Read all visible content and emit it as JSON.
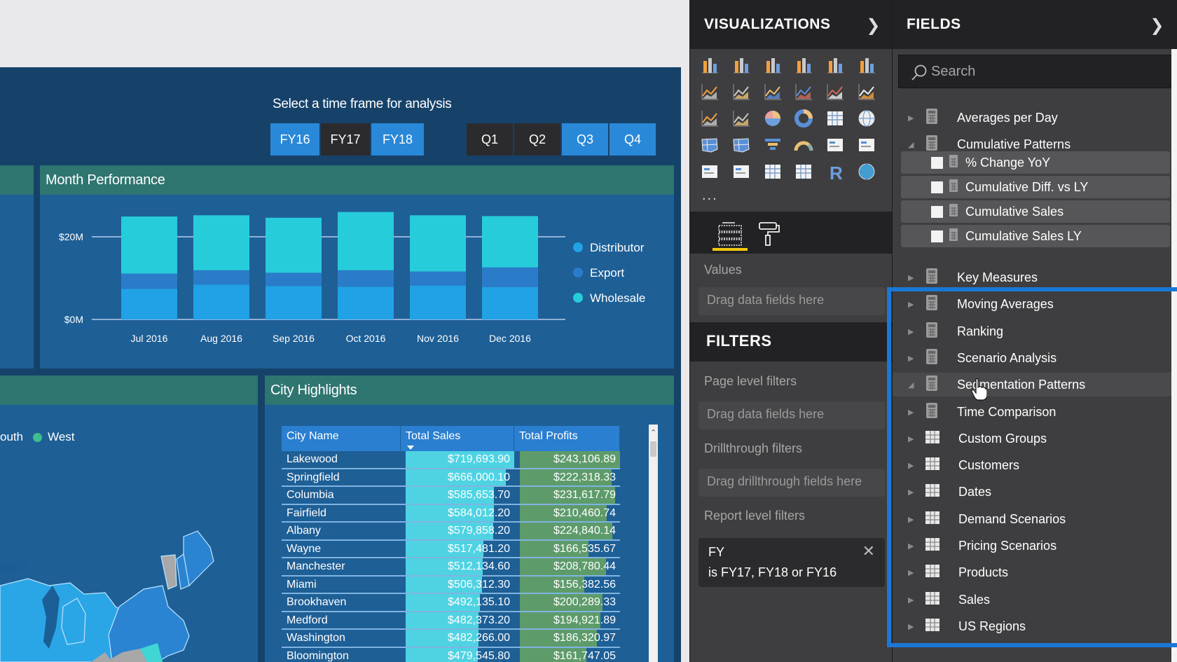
{
  "report": {
    "timeframe_title": "Select a time frame for analysis",
    "fy_buttons": [
      {
        "label": "FY16",
        "selected": true
      },
      {
        "label": "FY17",
        "selected": false
      },
      {
        "label": "FY18",
        "selected": true
      }
    ],
    "q_buttons": [
      {
        "label": "Q1",
        "selected": false
      },
      {
        "label": "Q2",
        "selected": false
      },
      {
        "label": "Q3",
        "selected": true
      },
      {
        "label": "Q4",
        "selected": true
      }
    ],
    "month_panel_title": "Month Performance",
    "city_panel_title": "City Highlights",
    "map_legend": [
      {
        "label": "outh",
        "color": "#2aa0e8"
      },
      {
        "label": "West",
        "color": "#3fbf8f"
      }
    ]
  },
  "chart_data": {
    "type": "bar",
    "stacked": true,
    "title": "Month Performance",
    "categories": [
      "Jul 2016",
      "Aug 2016",
      "Sep 2016",
      "Oct 2016",
      "Nov 2016",
      "Dec 2016"
    ],
    "series": [
      {
        "name": "Distributor",
        "color": "#21a2e6",
        "values": [
          7.4,
          8.4,
          8.1,
          7.9,
          8.2,
          7.8
        ]
      },
      {
        "name": "Export",
        "color": "#2a7cc9",
        "values": [
          3.7,
          3.5,
          3.2,
          4.0,
          3.4,
          4.8
        ]
      },
      {
        "name": "Wholesale",
        "color": "#27ccda",
        "values": [
          13.8,
          13.3,
          13.3,
          14.1,
          13.6,
          12.4
        ]
      }
    ],
    "units": "$M",
    "yticks": [
      {
        "value": 0,
        "label": "$0M"
      },
      {
        "value": 20,
        "label": "$20M"
      }
    ],
    "ylim": [
      0,
      28
    ],
    "grid": true,
    "legend_position": "right",
    "xlabel": "",
    "ylabel": ""
  },
  "city_table": {
    "columns": [
      "City Name",
      "Total Sales",
      "Total Profits"
    ],
    "sorted_column": "Total Sales",
    "sales_color": "#4fd3e3",
    "profit_color": "#5e9b6b",
    "max_sales": 719693.9,
    "max_profit": 243106.89,
    "rows": [
      {
        "city": "Lakewood",
        "sales": "$719,693.90",
        "sales_v": 719693.9,
        "profit": "$243,106.89",
        "profit_v": 243106.89
      },
      {
        "city": "Springfield",
        "sales": "$666,000.10",
        "sales_v": 666000.1,
        "profit": "$222,318.33",
        "profit_v": 222318.33
      },
      {
        "city": "Columbia",
        "sales": "$585,653.70",
        "sales_v": 585653.7,
        "profit": "$231,617.79",
        "profit_v": 231617.79
      },
      {
        "city": "Fairfield",
        "sales": "$584,012.20",
        "sales_v": 584012.2,
        "profit": "$210,460.74",
        "profit_v": 210460.74
      },
      {
        "city": "Albany",
        "sales": "$579,858.20",
        "sales_v": 579858.2,
        "profit": "$224,840.14",
        "profit_v": 224840.14
      },
      {
        "city": "Wayne",
        "sales": "$517,481.20",
        "sales_v": 517481.2,
        "profit": "$166,535.67",
        "profit_v": 166535.67
      },
      {
        "city": "Manchester",
        "sales": "$512,134.60",
        "sales_v": 512134.6,
        "profit": "$208,780.44",
        "profit_v": 208780.44
      },
      {
        "city": "Miami",
        "sales": "$506,312.30",
        "sales_v": 506312.3,
        "profit": "$156,382.56",
        "profit_v": 156382.56
      },
      {
        "city": "Brookhaven",
        "sales": "$492,135.10",
        "sales_v": 492135.1,
        "profit": "$200,289.33",
        "profit_v": 200289.33
      },
      {
        "city": "Medford",
        "sales": "$482,373.20",
        "sales_v": 482373.2,
        "profit": "$194,921.89",
        "profit_v": 194921.89
      },
      {
        "city": "Washington",
        "sales": "$482,266.00",
        "sales_v": 482266.0,
        "profit": "$186,320.97",
        "profit_v": 186320.97
      },
      {
        "city": "Bloomington",
        "sales": "$479,545.80",
        "sales_v": 479545.8,
        "profit": "$161,747.05",
        "profit_v": 161747.05
      }
    ]
  },
  "visualizations": {
    "title": "VISUALIZATIONS",
    "more": "...",
    "icons": [
      "stacked-bar-chart",
      "stacked-column-chart",
      "clustered-bar-chart",
      "clustered-column-chart",
      "100-stacked-bar-chart",
      "100-stacked-column-chart",
      "line-chart",
      "area-chart",
      "stacked-area-chart",
      "line-and-stacked-column-chart",
      "line-and-clustered-column-chart",
      "ribbon-chart",
      "waterfall-chart",
      "scatter-chart",
      "pie-chart",
      "donut-chart",
      "treemap",
      "map",
      "filled-map",
      "shape-map",
      "funnel",
      "gauge",
      "card",
      "multi-row-card",
      "kpi",
      "slicer",
      "table",
      "matrix",
      "r-script-visual",
      "arcgis-map"
    ],
    "values_label": "Values",
    "values_placeholder": "Drag data fields here"
  },
  "filters": {
    "title": "FILTERS",
    "page_level": "Page level filters",
    "page_placeholder": "Drag data fields here",
    "drillthrough": "Drillthrough filters",
    "drillthrough_placeholder": "Drag drillthrough fields here",
    "report_level": "Report level filters",
    "active_filter": {
      "field": "FY",
      "condition": "is FY17, FY18 or FY16"
    }
  },
  "fields": {
    "title": "FIELDS",
    "search_placeholder": "Search",
    "items": [
      {
        "label": "Averages per Day",
        "type": "measure-table",
        "expanded": false
      },
      {
        "label": "Cumulative Patterns",
        "type": "measure-table",
        "expanded": true,
        "children": [
          "% Change YoY",
          "Cumulative Diff. vs LY",
          "Cumulative Sales",
          "Cumulative Sales LY"
        ]
      },
      {
        "label": "Key Measures",
        "type": "measure-table",
        "expanded": false
      },
      {
        "label": "Moving Averages",
        "type": "measure-table",
        "expanded": false
      },
      {
        "label": "Ranking",
        "type": "measure-table",
        "expanded": false
      },
      {
        "label": "Scenario Analysis",
        "type": "measure-table",
        "expanded": false
      },
      {
        "label": "Segmentation Patterns",
        "type": "measure-table",
        "expanded": true,
        "hovered": true
      },
      {
        "label": "Time Comparison",
        "type": "measure-table",
        "expanded": false
      },
      {
        "label": "Custom Groups",
        "type": "table",
        "expanded": false
      },
      {
        "label": "Customers",
        "type": "table",
        "expanded": false
      },
      {
        "label": "Dates",
        "type": "table",
        "expanded": false
      },
      {
        "label": "Demand Scenarios",
        "type": "table",
        "expanded": false
      },
      {
        "label": "Pricing Scenarios",
        "type": "table",
        "expanded": false
      },
      {
        "label": "Products",
        "type": "table",
        "expanded": false
      },
      {
        "label": "Sales",
        "type": "table",
        "expanded": false
      },
      {
        "label": "US Regions",
        "type": "table",
        "expanded": false
      }
    ],
    "highlight_color": "#1a78d6"
  }
}
